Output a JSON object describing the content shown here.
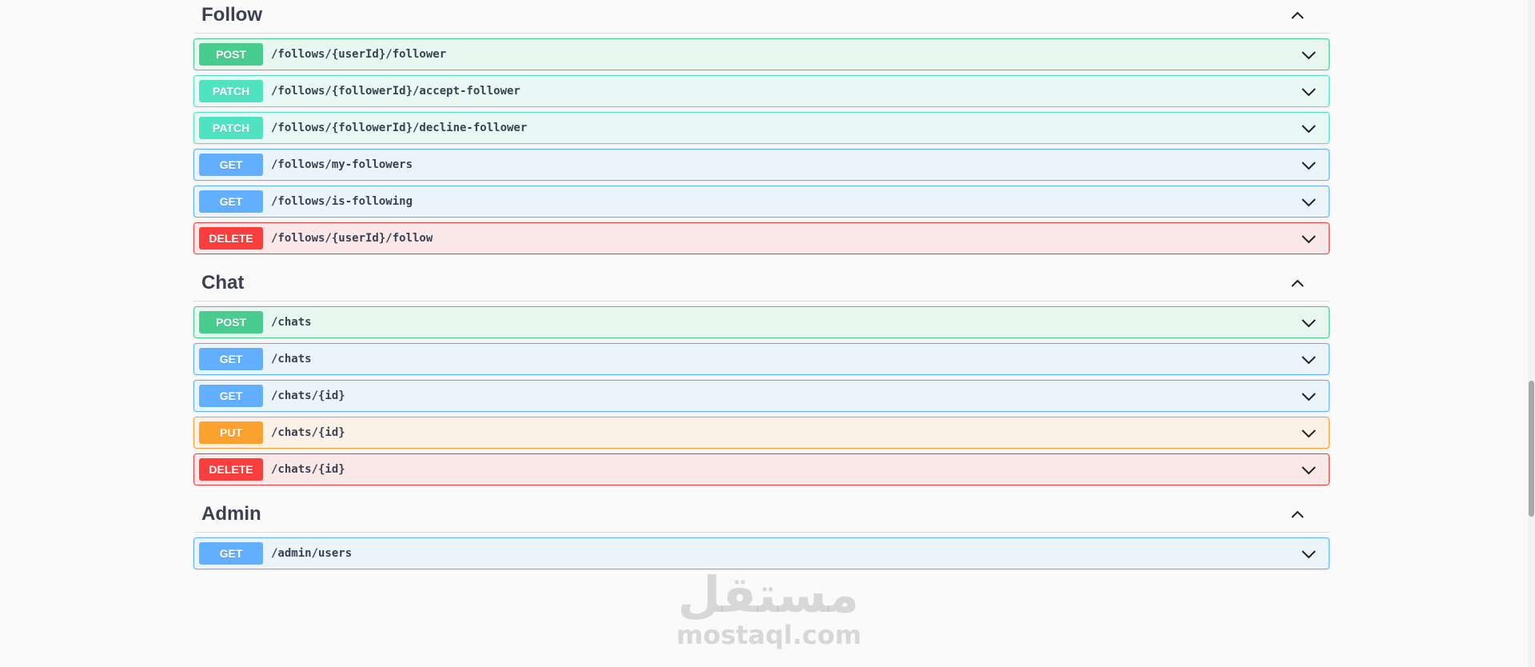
{
  "sections": [
    {
      "title": "Follow",
      "operations": [
        {
          "method": "POST",
          "path": "/follows/{userId}/follower"
        },
        {
          "method": "PATCH",
          "path": "/follows/{followerId}/accept-follower"
        },
        {
          "method": "PATCH",
          "path": "/follows/{followerId}/decline-follower"
        },
        {
          "method": "GET",
          "path": "/follows/my-followers"
        },
        {
          "method": "GET",
          "path": "/follows/is-following"
        },
        {
          "method": "DELETE",
          "path": "/follows/{userId}/follow"
        }
      ]
    },
    {
      "title": "Chat",
      "operations": [
        {
          "method": "POST",
          "path": "/chats"
        },
        {
          "method": "GET",
          "path": "/chats"
        },
        {
          "method": "GET",
          "path": "/chats/{id}"
        },
        {
          "method": "PUT",
          "path": "/chats/{id}"
        },
        {
          "method": "DELETE",
          "path": "/chats/{id}"
        }
      ]
    },
    {
      "title": "Admin",
      "operations": [
        {
          "method": "GET",
          "path": "/admin/users"
        }
      ]
    }
  ],
  "watermark": {
    "arabic": "مستقل",
    "latin": "mostaql.com"
  },
  "colors": {
    "post": "#49cc90",
    "patch": "#50e3c2",
    "get": "#61affe",
    "put": "#fca130",
    "delete": "#f93e3e",
    "text": "#3b4151"
  },
  "icons": {
    "section_toggle": "chevron-up-icon",
    "operation_toggle": "chevron-down-icon"
  }
}
